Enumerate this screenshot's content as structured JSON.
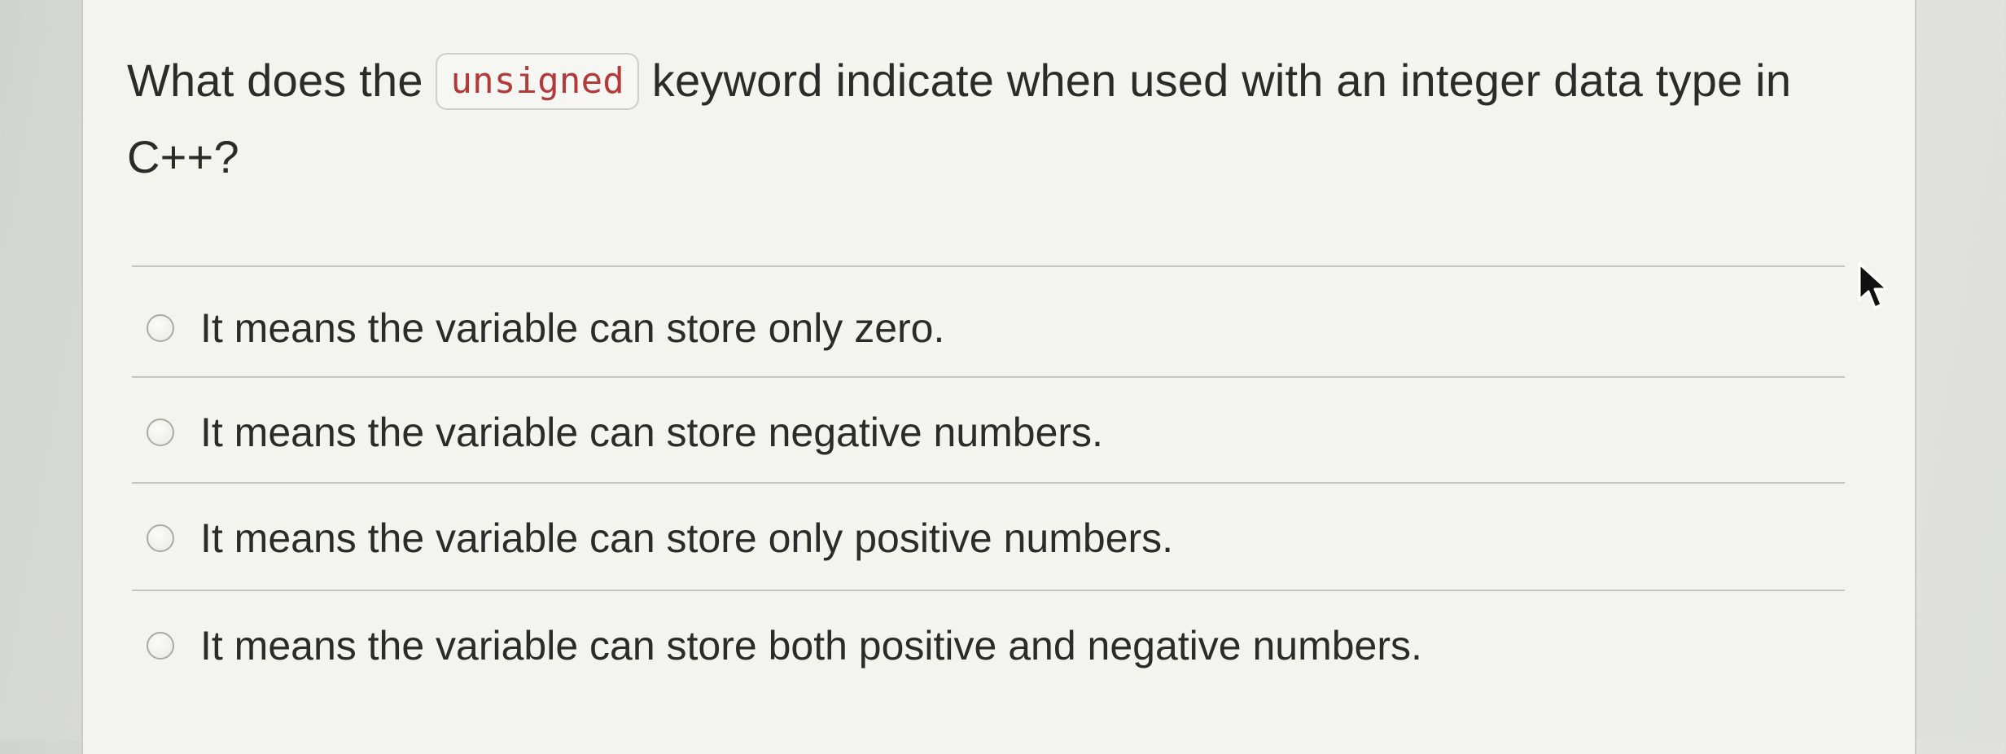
{
  "question": {
    "text_before": "What does the ",
    "code": "unsigned",
    "text_after": " keyword indicate when used with an integer data type in C++?"
  },
  "options": [
    {
      "label": "It means the variable can store only zero."
    },
    {
      "label": "It means the variable can store negative numbers."
    },
    {
      "label": "It means the variable can store only positive numbers."
    },
    {
      "label": "It means the variable can store both positive and negative numbers."
    }
  ],
  "icons": {
    "radio": "radio-circle-icon",
    "cursor": "mouse-pointer-icon"
  },
  "colors": {
    "code_text": "#b33a3a",
    "text": "#2b2b2b",
    "card": "#f3f3f0"
  }
}
